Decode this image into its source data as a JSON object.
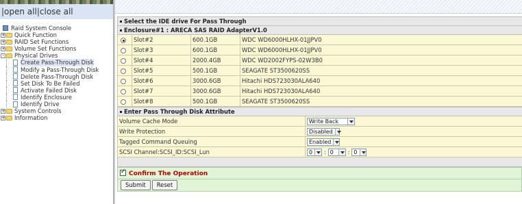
{
  "nav": {
    "open_all": "open all",
    "separator": "|",
    "close_all": "close all",
    "tree": [
      {
        "label": "Raid System Console",
        "icon": "computer-icon",
        "level": 0
      },
      {
        "label": "Quick Function",
        "icon": "folder-icon",
        "level": 0,
        "toggle": "+"
      },
      {
        "label": "RAID Set Functions",
        "icon": "folder-icon",
        "level": 0,
        "toggle": "+"
      },
      {
        "label": "Volume Set Functions",
        "icon": "folder-icon",
        "level": 0,
        "toggle": "+"
      },
      {
        "label": "Physical Drives",
        "icon": "folder-icon",
        "level": 0,
        "toggle": "-"
      },
      {
        "label": "Create Pass-Through Disk",
        "icon": "document-icon",
        "level": 1,
        "selected": true
      },
      {
        "label": "Modify a Pass-Through Disk",
        "icon": "document-icon",
        "level": 1
      },
      {
        "label": "Delete Pass-Through Disk",
        "icon": "document-icon",
        "level": 1
      },
      {
        "label": "Set Disk To Be Failed",
        "icon": "document-icon",
        "level": 1
      },
      {
        "label": "Activate Failed Disk",
        "icon": "document-icon",
        "level": 1
      },
      {
        "label": "Identify Enclosure",
        "icon": "document-icon",
        "level": 1
      },
      {
        "label": "Identify Drive",
        "icon": "document-icon",
        "level": 1
      },
      {
        "label": "System Controls",
        "icon": "folder-icon",
        "level": 0,
        "toggle": "+"
      },
      {
        "label": "Information",
        "icon": "folder-icon",
        "level": 0,
        "toggle": "+"
      }
    ]
  },
  "main": {
    "section_title": "Select the IDE drive For Pass Through",
    "enclosure_title": "Enclosure#1 : ARECA SAS RAID AdapterV1.0",
    "drives": [
      {
        "slot": "Slot#2",
        "capacity": "600.1GB",
        "model": "WDC WD6000HLHX-01JJPV0",
        "selected": true
      },
      {
        "slot": "Slot#3",
        "capacity": "600.1GB",
        "model": "WDC WD6000HLHX-01JJPV0",
        "selected": false
      },
      {
        "slot": "Slot#4",
        "capacity": "2000.4GB",
        "model": "WDC WD2002FYPS-02W3B0",
        "selected": false
      },
      {
        "slot": "Slot#5",
        "capacity": "500.1GB",
        "model": "SEAGATE ST3500620SS",
        "selected": false
      },
      {
        "slot": "Slot#6",
        "capacity": "3000.6GB",
        "model": "Hitachi HDS723030ALA640",
        "selected": false
      },
      {
        "slot": "Slot#7",
        "capacity": "3000.6GB",
        "model": "Hitachi HDS723030ALA640",
        "selected": false
      },
      {
        "slot": "Slot#8",
        "capacity": "500.1GB",
        "model": "SEAGATE ST3500620SS",
        "selected": false
      }
    ],
    "attr_title": "Enter Pass Through Disk Attribute",
    "attributes": {
      "volume_cache_mode": {
        "label": "Volume Cache Mode",
        "value": "Write Back"
      },
      "write_protection": {
        "label": "Write Protection",
        "value": "Disabled"
      },
      "tcq": {
        "label": "Tagged Command Queuing",
        "value": "Enabled"
      },
      "scsi": {
        "label": "SCSI Channel:SCSI_ID:SCSI_Lun",
        "channel": "0",
        "id": "0",
        "lun": "0",
        "sep": ":"
      }
    },
    "confirm_label": "Confirm The Operation",
    "confirm_checked": true,
    "submit_label": "Submit",
    "reset_label": "Reset"
  }
}
